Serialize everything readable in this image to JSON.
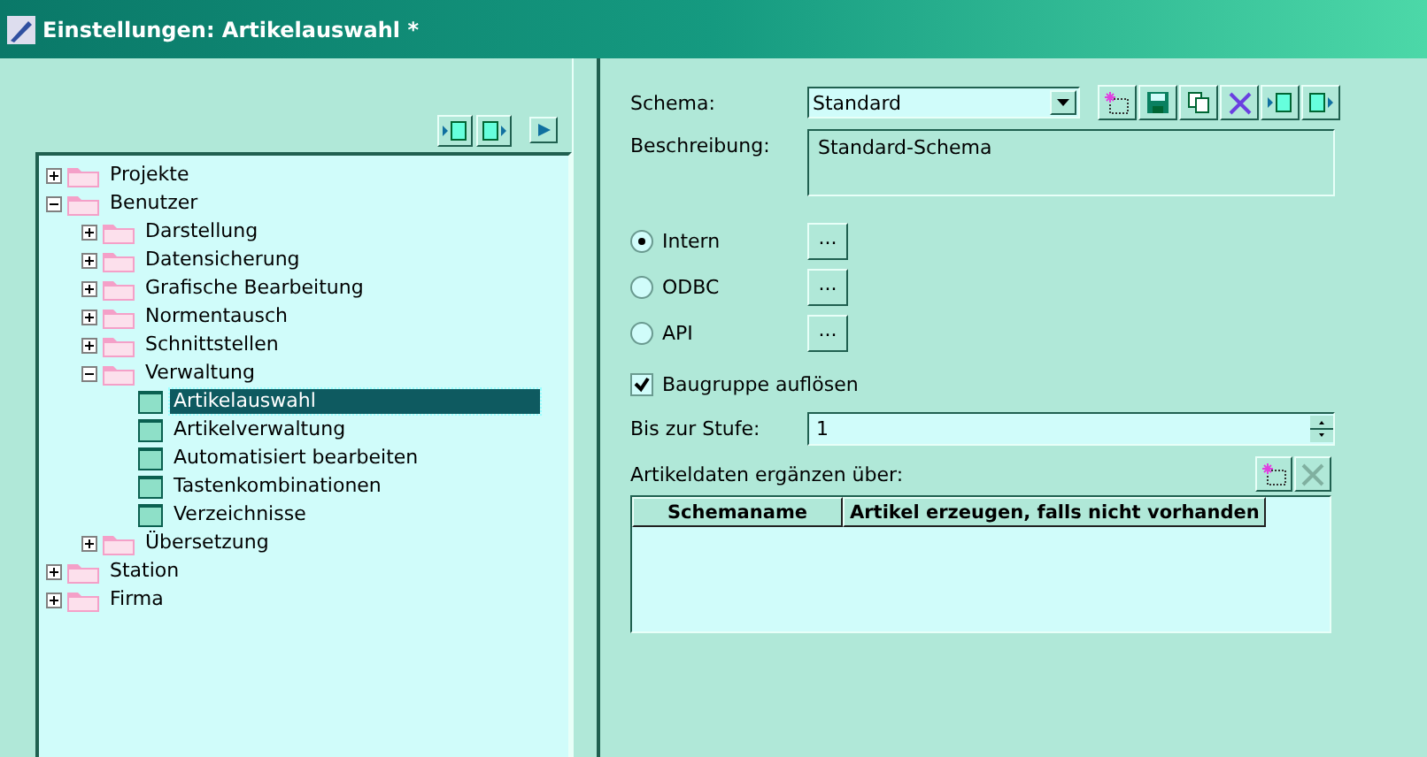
{
  "window": {
    "title": "Einstellungen: Artikelauswahl *"
  },
  "left_toolbar": [
    {
      "kind": "collapse"
    },
    {
      "kind": "expand"
    },
    {
      "kind": "play"
    }
  ],
  "tree": [
    {
      "label": "Projekte",
      "kind": "folder",
      "expanded": false,
      "selected": false
    },
    {
      "label": "Benutzer",
      "kind": "folder",
      "expanded": true,
      "selected": false,
      "children": [
        {
          "label": "Darstellung",
          "kind": "folder",
          "expanded": false,
          "selected": false
        },
        {
          "label": "Datensicherung",
          "kind": "folder",
          "expanded": false,
          "selected": false
        },
        {
          "label": "Grafische Bearbeitung",
          "kind": "folder",
          "expanded": false,
          "selected": false
        },
        {
          "label": "Normentausch",
          "kind": "folder",
          "expanded": false,
          "selected": false
        },
        {
          "label": "Schnittstellen",
          "kind": "folder",
          "expanded": false,
          "selected": false
        },
        {
          "label": "Verwaltung",
          "kind": "folder",
          "expanded": true,
          "selected": false,
          "children": [
            {
              "label": "Artikelauswahl",
              "kind": "page",
              "selected": true
            },
            {
              "label": "Artikelverwaltung",
              "kind": "page",
              "selected": false
            },
            {
              "label": "Automatisiert bearbeiten",
              "kind": "page",
              "selected": false
            },
            {
              "label": "Tastenkombinationen",
              "kind": "page",
              "selected": false
            },
            {
              "label": "Verzeichnisse",
              "kind": "page",
              "selected": false
            }
          ]
        },
        {
          "label": "Übersetzung",
          "kind": "folder",
          "expanded": false,
          "selected": false
        }
      ]
    },
    {
      "label": "Station",
      "kind": "folder",
      "expanded": false,
      "selected": false
    },
    {
      "label": "Firma",
      "kind": "folder",
      "expanded": false,
      "selected": false
    }
  ],
  "schema": {
    "label": "Schema:",
    "value": "Standard",
    "tools": [
      {
        "kind": "new"
      },
      {
        "kind": "save"
      },
      {
        "kind": "copy"
      },
      {
        "kind": "delete"
      },
      {
        "kind": "collapse"
      },
      {
        "kind": "expand"
      }
    ]
  },
  "description": {
    "label": "Beschreibung:",
    "value": "Standard-Schema"
  },
  "sources": [
    {
      "label": "Intern",
      "selected": true,
      "button": "..."
    },
    {
      "label": "ODBC",
      "selected": false,
      "button": "..."
    },
    {
      "label": "API",
      "selected": false,
      "button": "..."
    }
  ],
  "resolve_assembly": {
    "label": "Baugruppe auflösen",
    "checked": true
  },
  "level_field": {
    "label": "Bis zur Stufe:",
    "value": "1"
  },
  "supplement": {
    "label": "Artikeldaten ergänzen über:",
    "tools": [
      {
        "kind": "new"
      },
      {
        "kind": "delete",
        "disabled": true
      }
    ],
    "table": {
      "columns": [
        "Schemaname",
        "Artikel erzeugen, falls nicht vorhanden"
      ]
    }
  }
}
